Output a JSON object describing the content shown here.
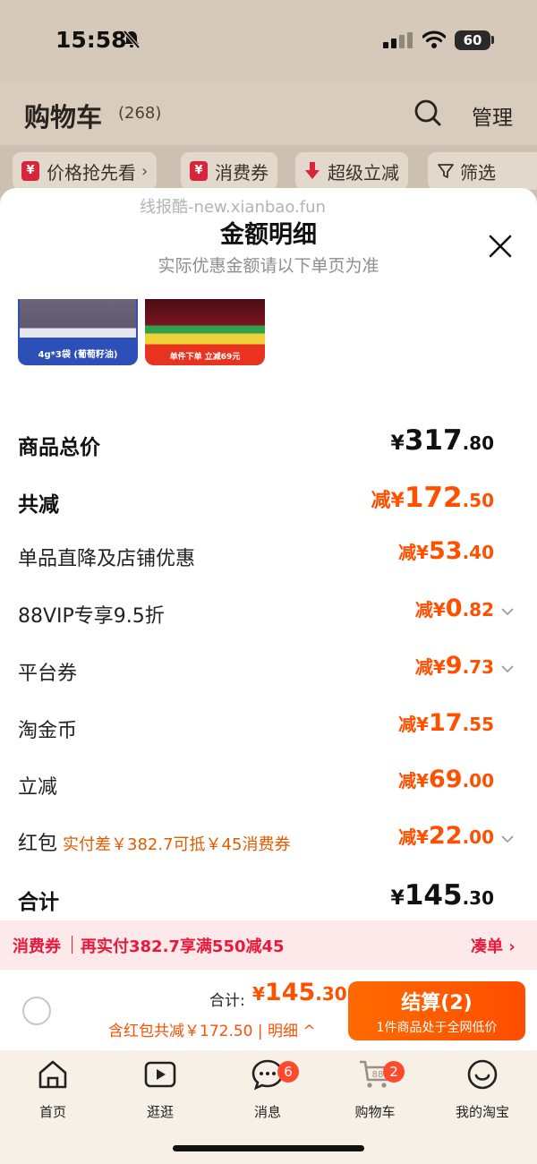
{
  "status_bar": {
    "time": "15:58",
    "battery": "60"
  },
  "header": {
    "title": "购物车",
    "count": "(268)",
    "manage_label": "管理"
  },
  "filters": [
    {
      "icon": "¥",
      "label": "价格抢先看",
      "chevron": "›"
    },
    {
      "icon": "¥",
      "label": "消费券"
    },
    {
      "label": "超级立减"
    },
    {
      "label": "筛选"
    }
  ],
  "sheet": {
    "watermark": "线报酷-new.xianbao.fun",
    "title": "金额明细",
    "subtitle": "实际优惠金额请以下单页为准",
    "thumbnails": [
      {
        "caption": "4g*3袋 (葡萄籽油)"
      },
      {
        "caption": "单件下单 立减69元"
      }
    ],
    "rows": [
      {
        "label": "商品总价",
        "prefix": "¥",
        "int": "317",
        "dec": ".80"
      },
      {
        "label": "共减",
        "prefix": "减¥",
        "int": "172",
        "dec": ".50"
      },
      {
        "label": "单品直降及店铺优惠",
        "prefix": "减¥",
        "int": "53",
        "dec": ".40"
      },
      {
        "label": "88VIP专享9.5折",
        "prefix": "减¥",
        "int": "0",
        "dec": ".82"
      },
      {
        "label": "平台券",
        "prefix": "减¥",
        "int": "9",
        "dec": ".73"
      },
      {
        "label": "淘金币",
        "prefix": "减¥",
        "int": "17",
        "dec": ".55"
      },
      {
        "label": "立减",
        "prefix": "减¥",
        "int": "69",
        "dec": ".00"
      },
      {
        "label": "红包",
        "hint": "实付差￥382.7可抵￥45消费券",
        "prefix": "减¥",
        "int": "22",
        "dec": ".00"
      },
      {
        "label": "合计",
        "prefix": "¥",
        "int": "145",
        "dec": ".30"
      }
    ]
  },
  "coupon_bar": {
    "tag": "消费券",
    "text": "再实付382.7享满550减45",
    "link": "凑单 ›"
  },
  "checkout": {
    "total_caption": "合计:",
    "total_prefix": "¥",
    "total_int": "145",
    "total_dec": ".30",
    "discount_line": "含红包共减￥172.50 | 明细 ^",
    "button_label": "结算(2)",
    "button_sub": "1件商品处于全网低价"
  },
  "tabs": [
    {
      "label": "首页",
      "icon": "home-icon"
    },
    {
      "label": "逛逛",
      "icon": "play-icon"
    },
    {
      "label": "消息",
      "icon": "message-icon",
      "badge": "6"
    },
    {
      "label": "购物车",
      "icon": "cart-icon",
      "badge": "2"
    },
    {
      "label": "我的淘宝",
      "icon": "profile-icon"
    }
  ],
  "colors": {
    "accent": "#ff5000",
    "coupon_red": "#e8193a",
    "background_beige": "#d9ccbd"
  }
}
